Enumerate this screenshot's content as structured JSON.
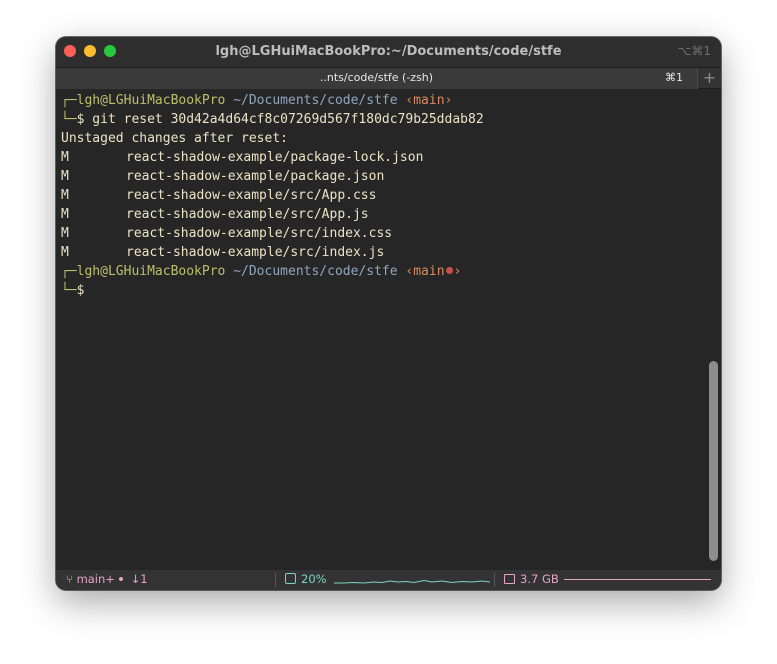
{
  "window": {
    "title": "lgh@LGHuiMacBookPro:~/Documents/code/stfe",
    "shortcut": "⌥⌘1"
  },
  "tabs": [
    {
      "title": "..nts/code/stfe (-zsh)",
      "shortcut": "⌘1"
    }
  ],
  "new_tab_label": "+",
  "terminal": {
    "prompt1": {
      "corner": "┌─",
      "userhost": "lgh@LGHuiMacBookPro",
      "path": "~/Documents/code/stfe",
      "branch": "‹main›"
    },
    "command1": {
      "corner": "└─",
      "symbol": "$",
      "text": " git reset 30d42a4d64cf8c07269d567f180dc79b25ddab82"
    },
    "output_header": "Unstaged changes after reset:",
    "files": [
      {
        "status": "M",
        "path": "react-shadow-example/package-lock.json"
      },
      {
        "status": "M",
        "path": "react-shadow-example/package.json"
      },
      {
        "status": "M",
        "path": "react-shadow-example/src/App.css"
      },
      {
        "status": "M",
        "path": "react-shadow-example/src/App.js"
      },
      {
        "status": "M",
        "path": "react-shadow-example/src/index.css"
      },
      {
        "status": "M",
        "path": "react-shadow-example/src/index.js"
      }
    ],
    "prompt2": {
      "corner": "┌─",
      "userhost": "lgh@LGHuiMacBookPro",
      "path": "~/Documents/code/stfe",
      "branch_open": "‹main",
      "branch_close": "›"
    },
    "command2": {
      "corner": "└─",
      "symbol": "$"
    }
  },
  "status_bar": {
    "git_branch_icon": "⑂",
    "git_branch": "main",
    "git_plus": "+",
    "git_behind": "↓1",
    "cpu": "20%",
    "memory": "3.7 GB"
  },
  "colors": {
    "green": "#b8c26a",
    "blue": "#8fa6bd",
    "orange": "#d98c5f",
    "pink": "#e6a2c7",
    "teal": "#78d6c0"
  }
}
